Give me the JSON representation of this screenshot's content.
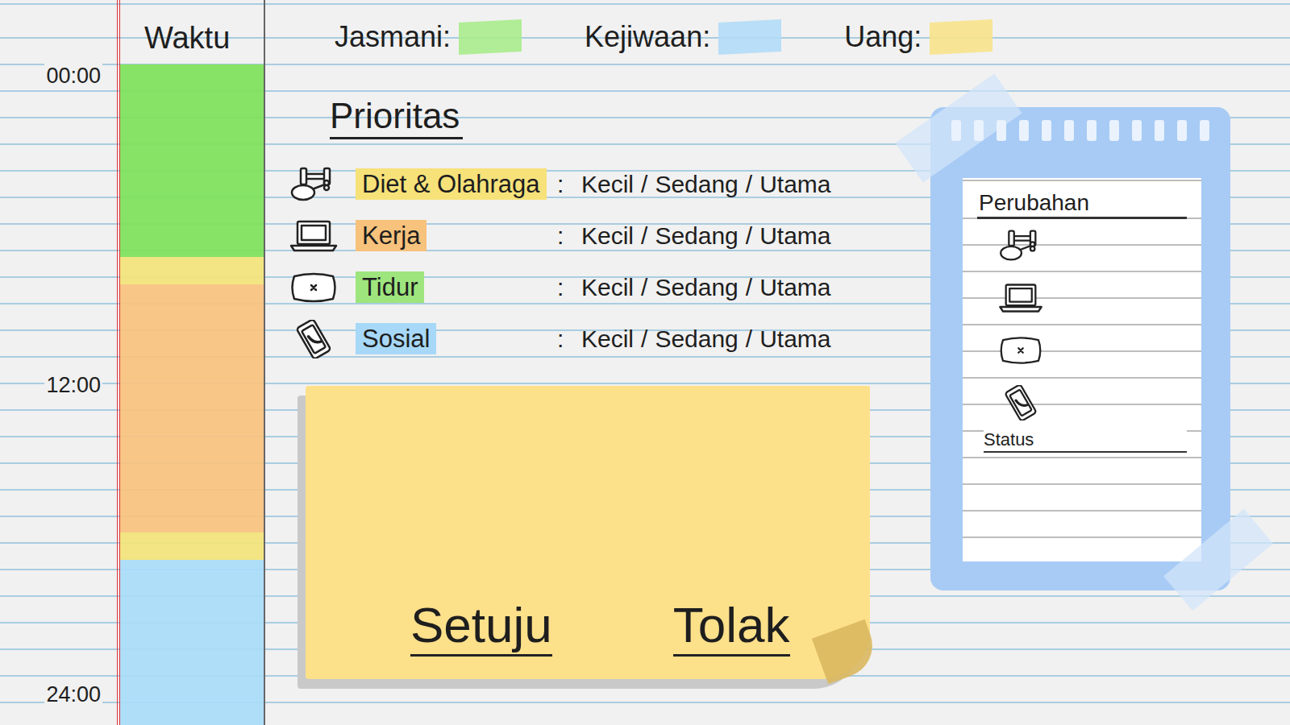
{
  "header": {
    "time_label": "Waktu"
  },
  "legend": [
    {
      "label": "Jasmani:",
      "color": "#a8ec8c"
    },
    {
      "label": "Kejiwaan:",
      "color": "#b3dcf7"
    },
    {
      "label": "Uang:",
      "color": "#f7e38b"
    }
  ],
  "time_axis": [
    "00:00",
    "12:00",
    "24:00"
  ],
  "schedule": [
    {
      "level": 0.2917,
      "color": "#7ee25a"
    },
    {
      "level": 0.0417,
      "color": "#f3e47a"
    },
    {
      "level": 0.375,
      "color": "#f8c27e"
    },
    {
      "level": 0.0417,
      "color": "#f3e47a"
    },
    {
      "level": 0.25,
      "color": "#a9dcf8"
    }
  ],
  "priorities": {
    "title": "Prioritas",
    "separator": ":",
    "option_separator": "/",
    "rows": [
      {
        "label": "Diet & Olahraga",
        "kind": "diet",
        "color": "#f7e27a",
        "options": [
          {
            "label": "Kecil",
            "selected": false
          },
          {
            "label": "Sedang",
            "selected": false
          },
          {
            "label": "Utama",
            "selected": false
          }
        ]
      },
      {
        "label": "Kerja",
        "kind": "work",
        "color": "#f7c27c",
        "options": [
          {
            "label": "Kecil",
            "selected": false
          },
          {
            "label": "Sedang",
            "selected": false
          },
          {
            "label": "Utama",
            "selected": false
          }
        ]
      },
      {
        "label": "Tidur",
        "kind": "sleep",
        "color": "#9ee57e",
        "options": [
          {
            "label": "Kecil",
            "selected": false
          },
          {
            "label": "Sedang",
            "selected": false
          },
          {
            "label": "Utama",
            "selected": false
          }
        ]
      },
      {
        "label": "Sosial",
        "kind": "social",
        "color": "#a7d8f7",
        "options": [
          {
            "label": "Kecil",
            "selected": false
          },
          {
            "label": "Sedang",
            "selected": false
          },
          {
            "label": "Utama",
            "selected": false
          }
        ]
      }
    ]
  },
  "decision": {
    "buttons": [
      {
        "label": "Setuju"
      },
      {
        "label": "Tolak"
      }
    ]
  },
  "changes": {
    "title": "Perubahan",
    "status_label": "Status"
  }
}
